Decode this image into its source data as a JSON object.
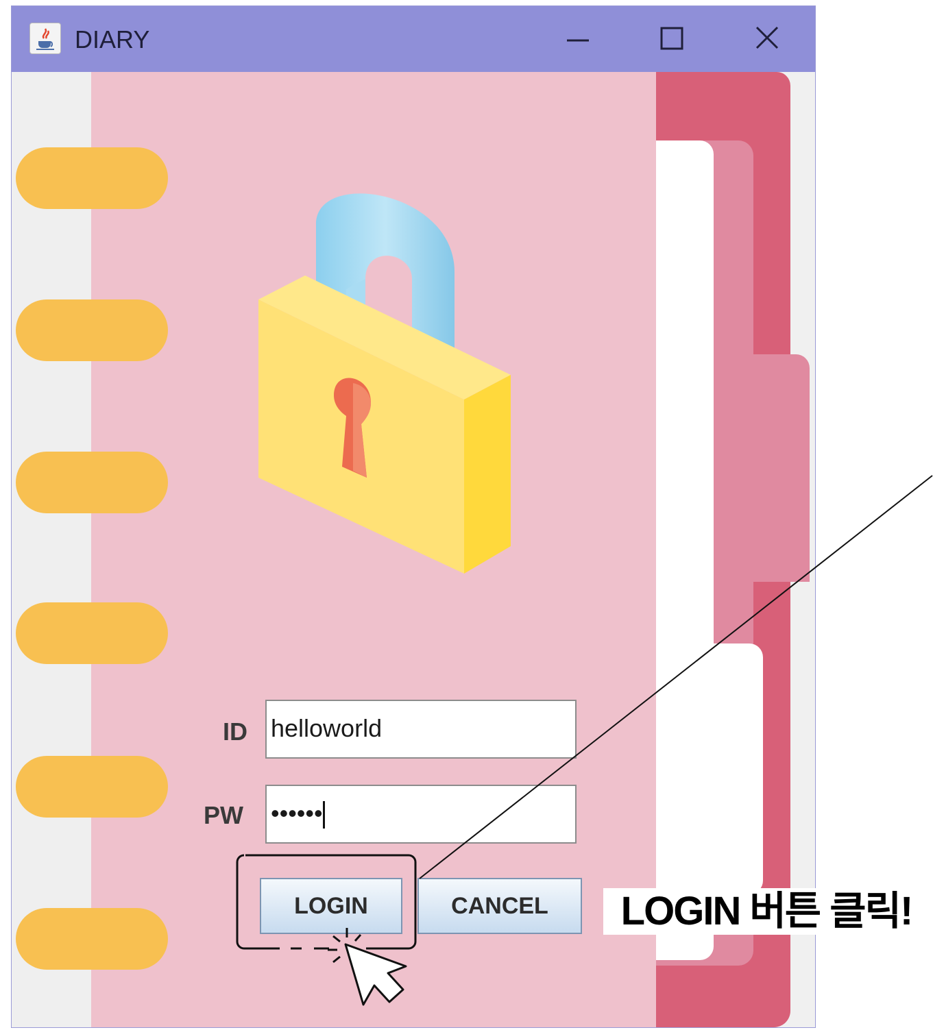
{
  "window": {
    "title": "DIARY",
    "icons": {
      "app": "java-cup-icon",
      "minimize": "minimize-icon",
      "maximize": "maximize-icon",
      "close": "close-icon"
    }
  },
  "form": {
    "id_label": "ID",
    "id_value": "helloworld",
    "pw_label": "PW",
    "pw_value": "••••••",
    "login_label": "LOGIN",
    "cancel_label": "CANCEL"
  },
  "illustration": {
    "icon": "padlock-icon",
    "colors": {
      "body": "#ffe176",
      "shackle": "#9dd6f2",
      "keyhole": "#ec6b4f"
    }
  },
  "annotation": {
    "text": "LOGIN 버튼 클릭!",
    "icon": "cursor-click-icon"
  },
  "colors": {
    "titlebar": "#8f8fd8",
    "page": "#efc1cc",
    "rings": "#f8c051",
    "tabs_dark": "#d86078",
    "tabs_mid": "#e08aa0"
  }
}
